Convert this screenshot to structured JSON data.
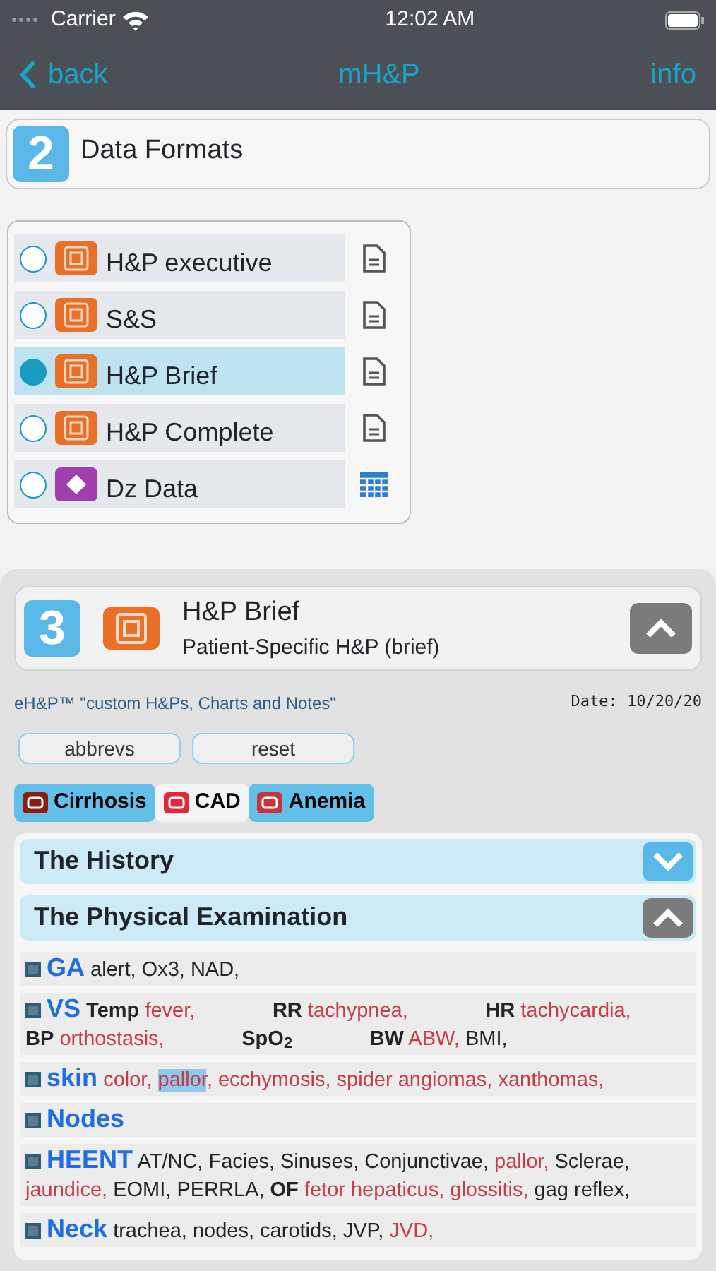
{
  "status_bar": {
    "carrier": "Carrier",
    "time": "12:02 AM"
  },
  "nav_bar": {
    "back": "back",
    "title": "mH&P",
    "info": "info"
  },
  "step_2": {
    "number": "2",
    "title": "Data Formats"
  },
  "formats": [
    {
      "label": "H&P executive",
      "kind": "document",
      "selected": false
    },
    {
      "label": "S&S",
      "kind": "document",
      "selected": false
    },
    {
      "label": "H&P Brief",
      "kind": "document",
      "selected": true
    },
    {
      "label": "H&P Complete",
      "kind": "document",
      "selected": false
    },
    {
      "label": "Dz Data",
      "kind": "table",
      "selected": false
    }
  ],
  "step_3": {
    "number": "3",
    "title": "H&P Brief",
    "subtitle": "Patient-Specific H&P (brief)",
    "expanded": true
  },
  "tagline": "eH&P™ \"custom H&Ps, Charts and Notes\"",
  "date": "Date: 10/20/20",
  "buttons": [
    "abbrevs",
    "reset"
  ],
  "conditions": [
    {
      "label": "Cirrhosis",
      "color": "#8a1c12",
      "selected": true
    },
    {
      "label": "CAD",
      "color": "#e0283a",
      "selected": false
    },
    {
      "label": "Anemia",
      "color": "#c8343c",
      "selected": true
    }
  ],
  "sections": [
    {
      "title": "The History",
      "expanded": false
    },
    {
      "title": "The Physical Examination",
      "expanded": true
    }
  ],
  "exam_rows": [
    {
      "heading": "GA",
      "segments": [
        {
          "kind": "normal",
          "text": "alert, Ox3, NAD,"
        }
      ]
    },
    {
      "heading": "VS",
      "segments": [
        {
          "kind": "label",
          "text": "Temp"
        },
        {
          "kind": "finding",
          "text": "fever,"
        },
        {
          "kind": "tab",
          "text": "RR"
        },
        {
          "kind": "finding",
          "text": "tachypnea,"
        },
        {
          "kind": "tab",
          "text": "HR"
        },
        {
          "kind": "finding",
          "text": "tachycardia,"
        },
        {
          "kind": "break",
          "text": "BP"
        },
        {
          "kind": "finding",
          "text": "orthostasis,"
        },
        {
          "kind": "tab",
          "text": "SpO$_{2}$"
        },
        {
          "kind": "tab",
          "text": "BW"
        },
        {
          "kind": "finding",
          "text": "ABW,"
        },
        {
          "kind": "normal",
          "text": "BMI,"
        }
      ]
    },
    {
      "heading": "skin",
      "segments": [
        {
          "kind": "finding",
          "text": "color,"
        },
        {
          "kind": "marked",
          "text": "pallor"
        },
        {
          "kind": "finding",
          "text": ", ecchymosis, spider angiomas, xanthomas,"
        }
      ]
    },
    {
      "heading": "Nodes",
      "segments": []
    },
    {
      "heading": "HEENT",
      "segments": [
        {
          "kind": "normal",
          "text": "AT/NC, Facies, Sinuses, Conjunctivae,"
        },
        {
          "kind": "finding",
          "text": "pallor,"
        },
        {
          "kind": "normal",
          "text": "Sclerae,"
        },
        {
          "kind": "finding",
          "text": "jaundice,"
        },
        {
          "kind": "normal",
          "text": "EOMI, PERRLA,"
        },
        {
          "kind": "label",
          "text": "OF"
        },
        {
          "kind": "finding",
          "text": "fetor hepaticus, glossitis,"
        },
        {
          "kind": "normal",
          "text": "gag reflex,"
        }
      ]
    },
    {
      "heading": "Neck",
      "segments": [
        {
          "kind": "normal",
          "text": "trachea, nodes, carotids, JVP,"
        },
        {
          "kind": "finding",
          "text": "JVD,"
        }
      ]
    }
  ]
}
